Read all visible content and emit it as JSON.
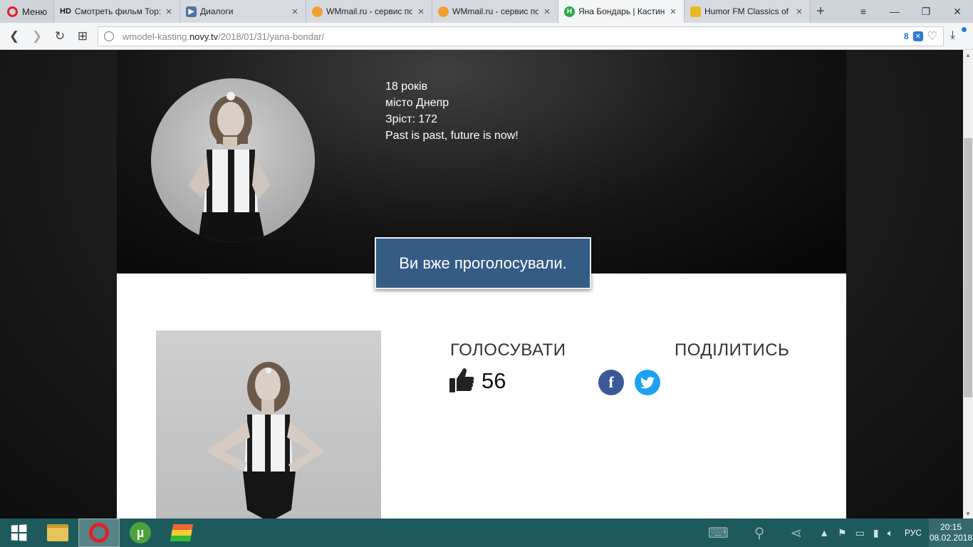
{
  "browser": {
    "menu_label": "Меню",
    "tabs": [
      {
        "title": "Смотреть фильм Тор: Р",
        "favicon": "HD",
        "favicon_color": "#ffffff",
        "favicon_text_color": "#222222"
      },
      {
        "title": "Диалоги",
        "favicon": "vk-icon",
        "favicon_color": "#4a76a8"
      },
      {
        "title": "WMmail.ru - сервис по",
        "favicon": "wmmail-icon",
        "favicon_color": "#f0a030"
      },
      {
        "title": "WMmail.ru - сервис по",
        "favicon": "wmmail-icon",
        "favicon_color": "#f0a030"
      },
      {
        "title": "Яна Бондарь | Кастинг",
        "favicon": "novy-icon",
        "favicon_color": "#2aa84a",
        "active": true
      },
      {
        "title": "Humor FM Classics of th",
        "favicon": "humorfm-icon",
        "favicon_color": "#e8b820"
      }
    ],
    "address": {
      "prefix": "wmodel-kasting.",
      "domain": "novy.tv",
      "path": "/2018/01/31/yana-bondar/"
    },
    "blocked_count": "8"
  },
  "profile": {
    "age": "18 років",
    "city": "місто Днепр",
    "height": "Зріст: 172",
    "motto": "Past is past, future is now!",
    "voted_message": "Ви вже проголосували."
  },
  "vote": {
    "heading": "ГОЛОСУВАТИ",
    "count": "56"
  },
  "share": {
    "heading": "ПОДІЛИТИСЬ",
    "facebook_letter": "f"
  },
  "taskbar": {
    "language": "РУС",
    "time": "20:15",
    "date": "08.02.2018"
  },
  "colors": {
    "voted_button": "#345c85",
    "facebook": "#3b5998",
    "twitter": "#1da1f2",
    "taskbar": "#1e5a5c"
  }
}
